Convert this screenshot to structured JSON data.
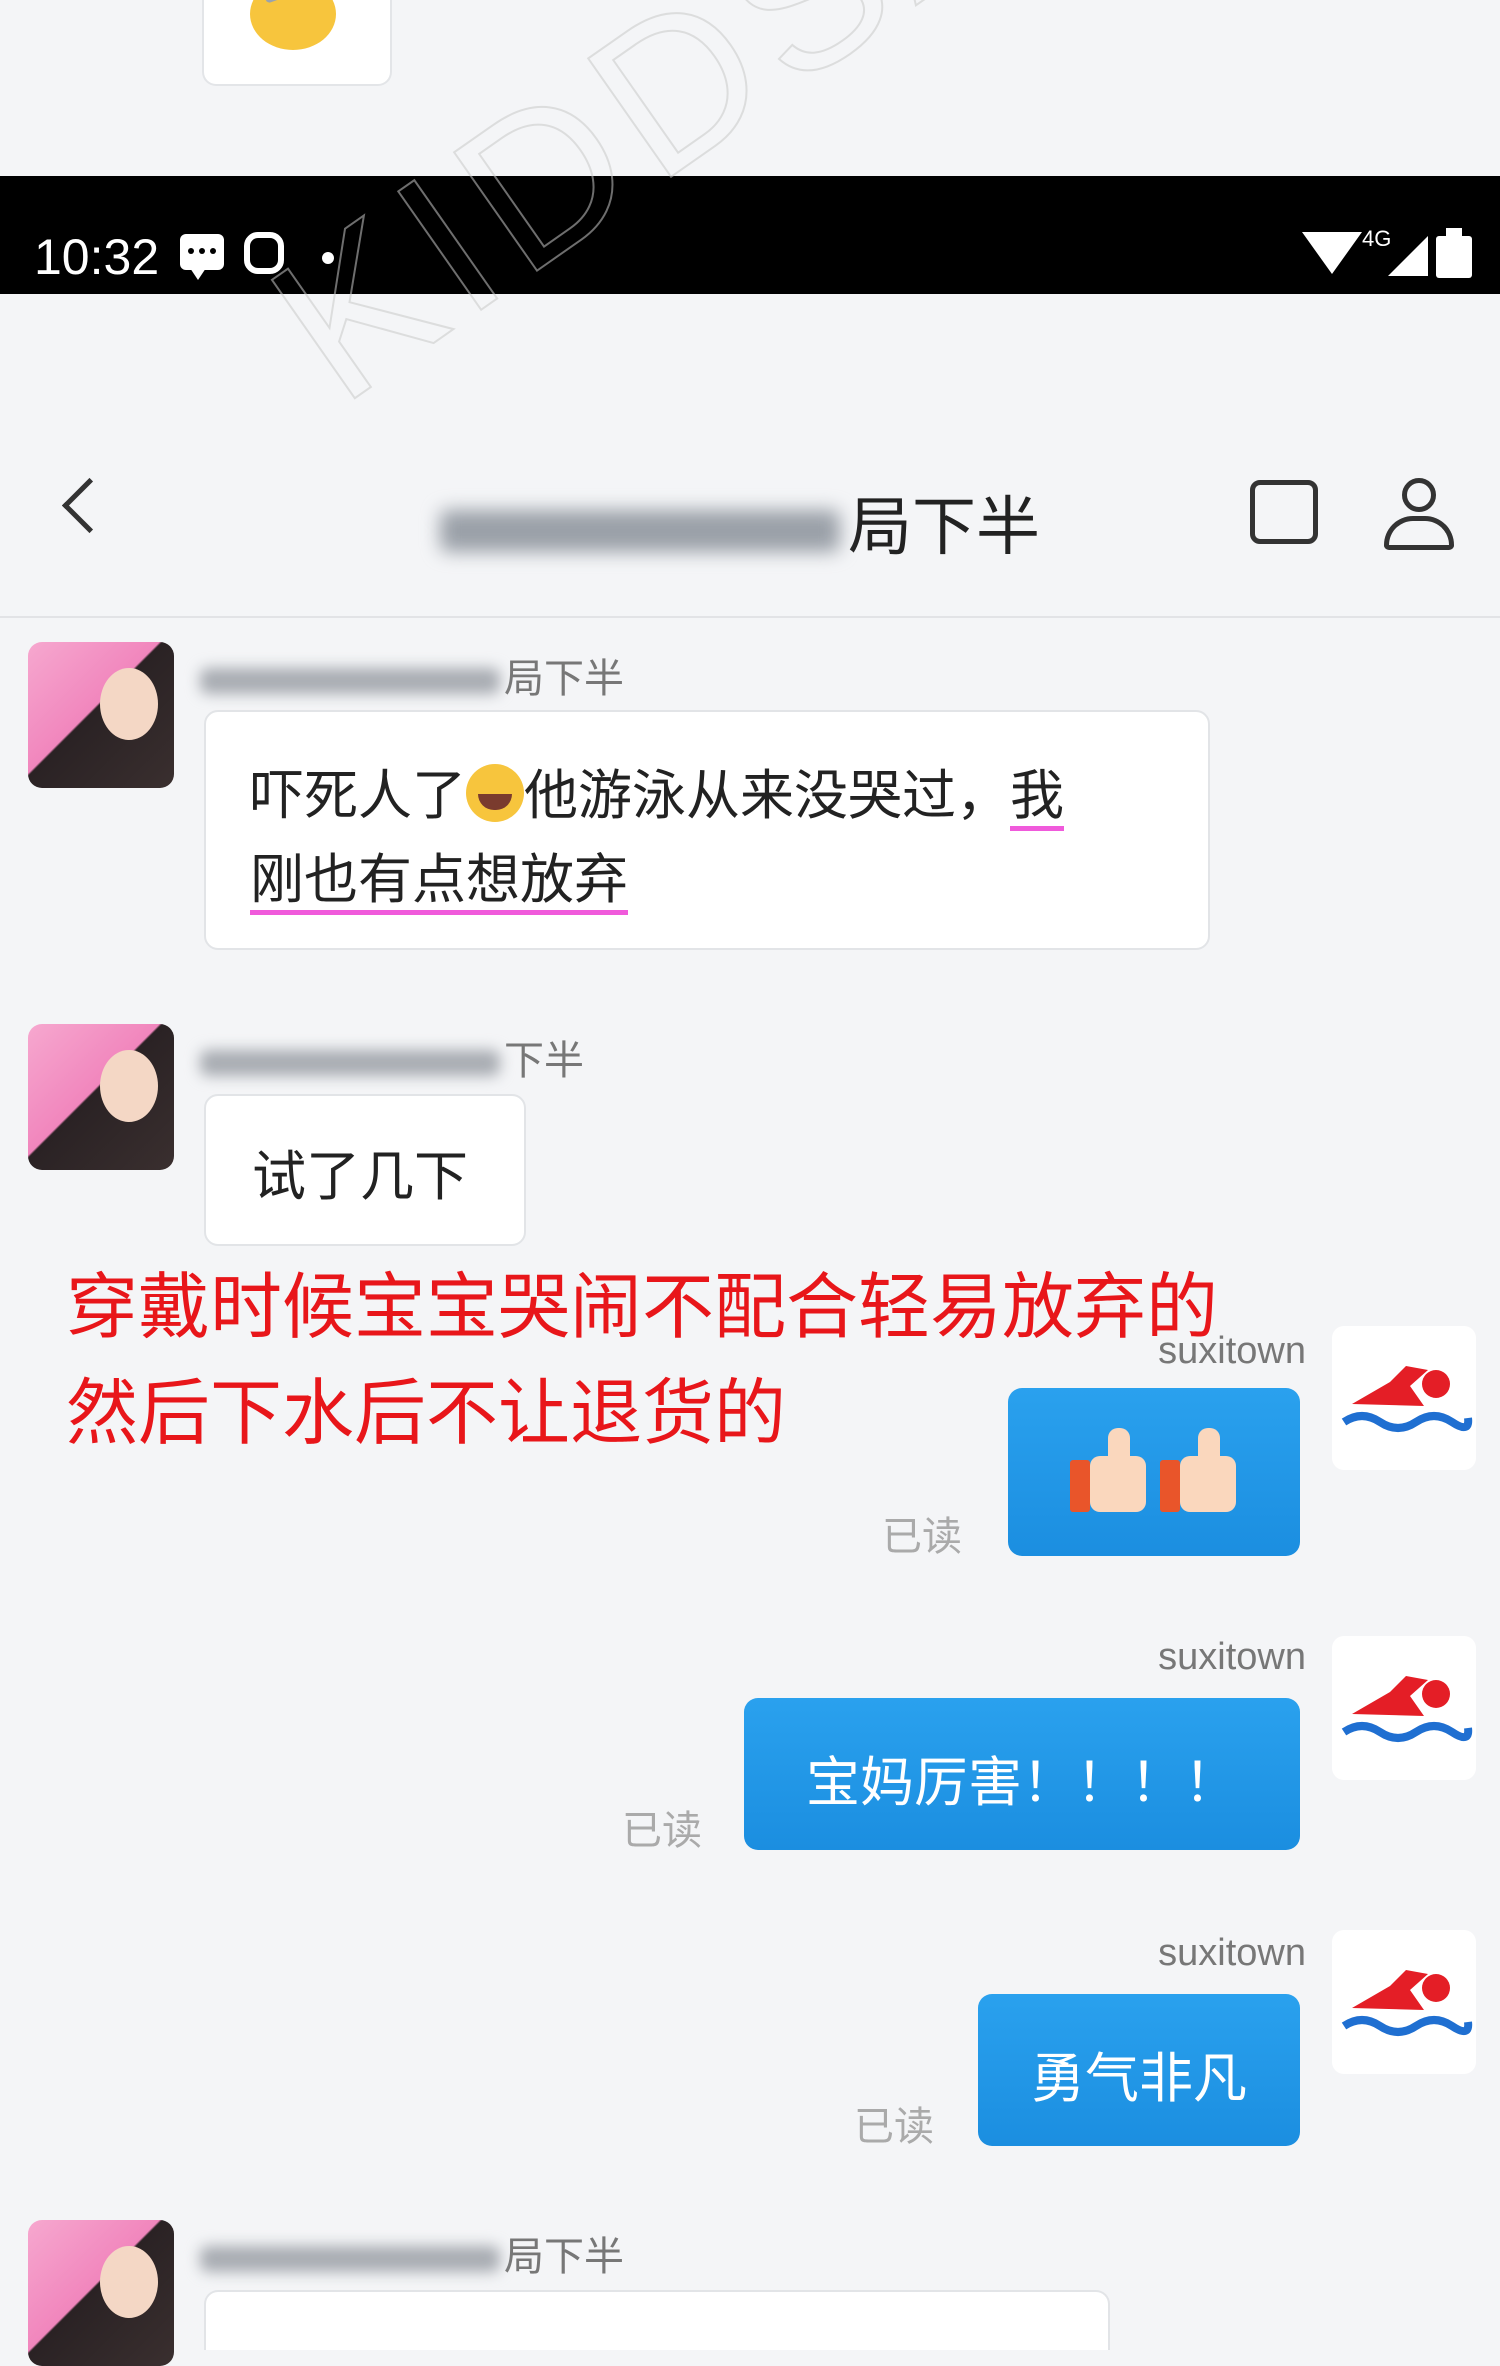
{
  "status_bar": {
    "time": "10:32",
    "network": "4G"
  },
  "header": {
    "title_visible": "局下半"
  },
  "watermark": "KIDDSAFE",
  "messages": [
    {
      "side": "in",
      "sender_visible": "局下半",
      "text_line1_a": "吓死人了",
      "text_line1_b": "他游泳从来没哭过，",
      "text_line1_c": "我",
      "text_line2": "刚也有点想放弃"
    },
    {
      "side": "in",
      "sender_visible": "下半",
      "text": "试了几下"
    },
    {
      "side": "out",
      "sender": "suxitown",
      "read": "已读"
    },
    {
      "side": "out",
      "sender": "suxitown",
      "text": "宝妈厉害！！！！",
      "read": "已读"
    },
    {
      "side": "out",
      "sender": "suxitown",
      "text": "勇气非凡",
      "read": "已读"
    },
    {
      "side": "in",
      "sender_visible": "局下半"
    }
  ],
  "annotation": {
    "line1": "穿戴时候宝宝哭闹不配合轻易放弃的",
    "line2": "然后下水后不让退货的"
  },
  "colors": {
    "accent_blue": "#1f95e6",
    "annotation_red": "#e8161a",
    "underline_pink": "#f05adb"
  },
  "icons": [
    "back-arrow-icon",
    "shop-icon",
    "profile-icon",
    "wifi-icon",
    "signal-icon",
    "battery-icon",
    "swimmer-icon"
  ]
}
